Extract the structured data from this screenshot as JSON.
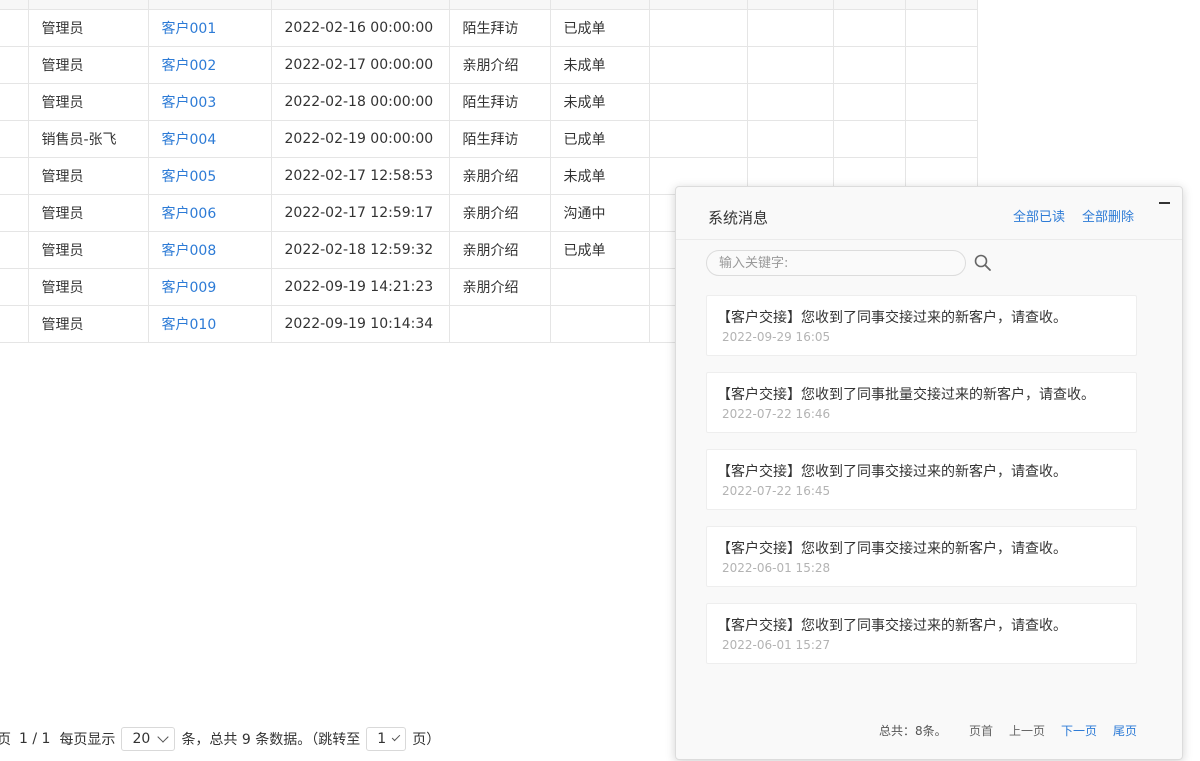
{
  "table": {
    "rows": [
      {
        "owner": "管理员",
        "customer": "客户001",
        "time": "2022-02-16 00:00:00",
        "source": "陌生拜访",
        "status": "已成单"
      },
      {
        "owner": "管理员",
        "customer": "客户002",
        "time": "2022-02-17 00:00:00",
        "source": "亲朋介绍",
        "status": "未成单"
      },
      {
        "owner": "管理员",
        "customer": "客户003",
        "time": "2022-02-18 00:00:00",
        "source": "陌生拜访",
        "status": "未成单"
      },
      {
        "owner": "销售员-张飞",
        "customer": "客户004",
        "time": "2022-02-19 00:00:00",
        "source": "陌生拜访",
        "status": "已成单"
      },
      {
        "owner": "管理员",
        "customer": "客户005",
        "time": "2022-02-17 12:58:53",
        "source": "亲朋介绍",
        "status": "未成单"
      },
      {
        "owner": "管理员",
        "customer": "客户006",
        "time": "2022-02-17 12:59:17",
        "source": "亲朋介绍",
        "status": "沟通中"
      },
      {
        "owner": "管理员",
        "customer": "客户008",
        "time": "2022-02-18 12:59:32",
        "source": "亲朋介绍",
        "status": "已成单"
      },
      {
        "owner": "管理员",
        "customer": "客户009",
        "time": "2022-09-19 14:21:23",
        "source": "亲朋介绍",
        "status": ""
      },
      {
        "owner": "管理员",
        "customer": "客户010",
        "time": "2022-09-19 10:14:34",
        "source": "",
        "status": ""
      }
    ]
  },
  "pagination": {
    "page_edge": "页",
    "page_info": "1 / 1",
    "per_page_label": "每页显示",
    "per_page_value": "20",
    "summary": "条，总共 9 条数据。（跳转至",
    "jump_value": "1",
    "page_suffix": "页）"
  },
  "panel": {
    "title": "系统消息",
    "mark_all_read": "全部已读",
    "delete_all": "全部删除",
    "search_placeholder": "输入关键字:",
    "messages": [
      {
        "text": "【客户交接】您收到了同事交接过来的新客户，请查收。",
        "time": "2022-09-29 16:05"
      },
      {
        "text": "【客户交接】您收到了同事批量交接过来的新客户，请查收。",
        "time": "2022-07-22 16:46"
      },
      {
        "text": "【客户交接】您收到了同事交接过来的新客户，请查收。",
        "time": "2022-07-22 16:45"
      },
      {
        "text": "【客户交接】您收到了同事交接过来的新客户，请查收。",
        "time": "2022-06-01 15:28"
      },
      {
        "text": "【客户交接】您收到了同事交接过来的新客户，请查收。",
        "time": "2022-06-01 15:27"
      }
    ],
    "footer": {
      "total": "总共：8条。",
      "first": "页首",
      "prev": "上一页",
      "next": "下一页",
      "last": "尾页"
    }
  },
  "colors": {
    "link": "#2d7bd6",
    "border": "#e5e5e5",
    "muted": "#b3b3b3"
  }
}
